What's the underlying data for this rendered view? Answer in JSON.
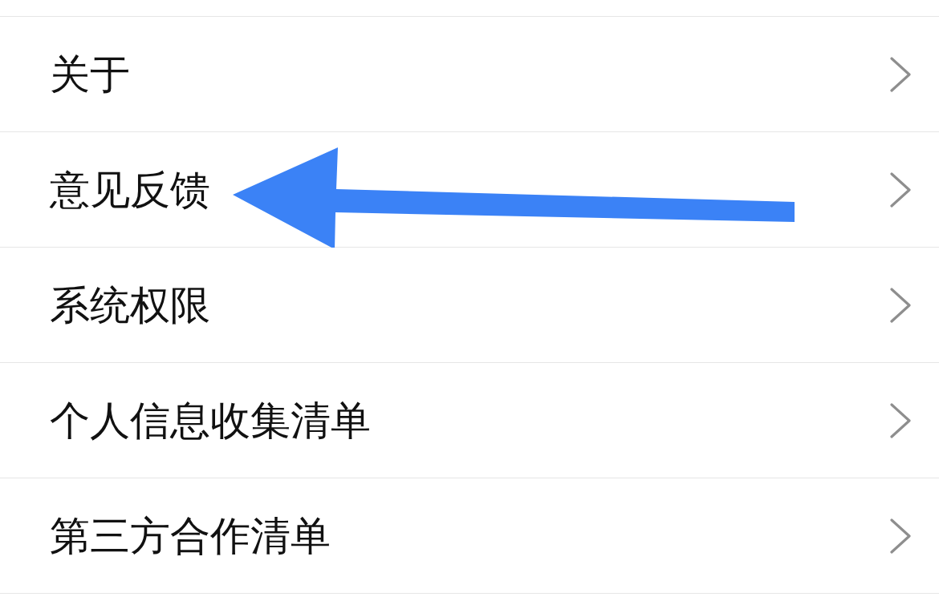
{
  "settings_items": [
    {
      "label": "关于",
      "annotated": false
    },
    {
      "label": "意见反馈",
      "annotated": true
    },
    {
      "label": "系统权限",
      "annotated": false
    },
    {
      "label": "个人信息收集清单",
      "annotated": false
    },
    {
      "label": "第三方合作清单",
      "annotated": false
    }
  ]
}
